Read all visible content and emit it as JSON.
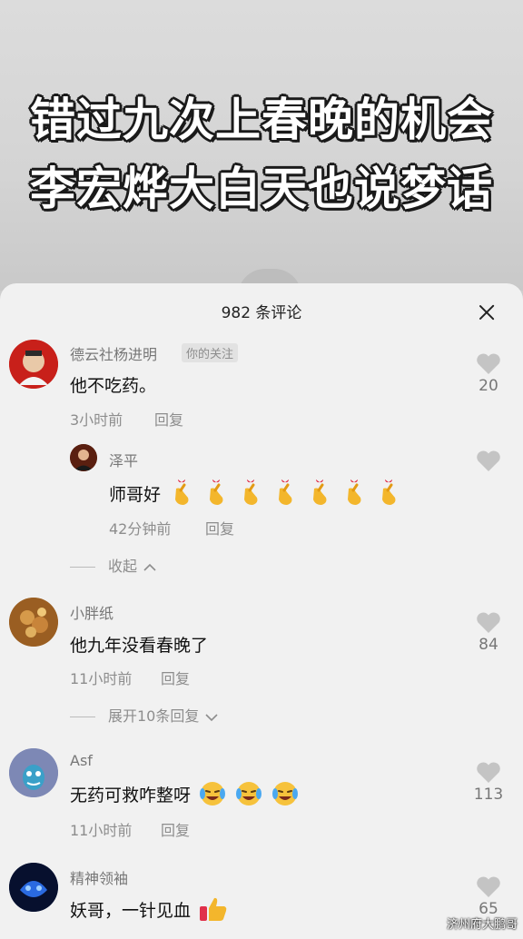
{
  "video": {
    "title_line1": "错过九次上春晚的机会",
    "title_line2": "李宏烨大白天也说梦话"
  },
  "sheet": {
    "header": "982 条评论",
    "close_icon": "close-icon"
  },
  "comments": [
    {
      "name": "德云社杨进明",
      "tag": "你的关注",
      "text": "他不吃药。",
      "time": "3小时前",
      "reply": "回复",
      "likes": "20",
      "avatar_color": "#c8201a"
    },
    {
      "name": "泽平",
      "text": "师哥好",
      "emoji_count": 7,
      "time": "42分钟前",
      "reply": "回复",
      "likes": "",
      "avatar_color": "#5a1f10"
    },
    {
      "name": "小胖纸",
      "text": "他九年没看春晚了",
      "time": "11小时前",
      "reply": "回复",
      "likes": "84",
      "avatar_color": "#b07a3a"
    },
    {
      "name": "Asf",
      "text": "无药可救咋整呀",
      "emoji_count": 3,
      "time": "11小时前",
      "reply": "回复",
      "likes": "113",
      "avatar_color": "#7d88b5"
    },
    {
      "name": "精神领袖",
      "text": "妖哥，一针见血",
      "time": "",
      "reply": "",
      "likes": "65",
      "avatar_color": "#10204a"
    }
  ],
  "folds": {
    "collapse": "收起",
    "expand": "展开10条回复"
  },
  "watermark": "济州府大鹏哥"
}
